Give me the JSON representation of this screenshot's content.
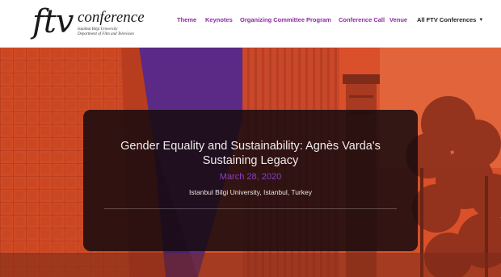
{
  "logo": {
    "main": "ftv",
    "word": "conference",
    "sub_lines": [
      "Istanbul Bilgi University",
      "Department of Film and Television"
    ]
  },
  "nav": {
    "items": [
      {
        "label": "Theme"
      },
      {
        "label": "Keynotes"
      },
      {
        "label": "Organizing Committee"
      },
      {
        "label": "Program"
      },
      {
        "label": "Conference Call"
      },
      {
        "label": "Venue"
      }
    ],
    "dropdown": {
      "label": "All FTV Conferences",
      "caret": "▼"
    }
  },
  "event": {
    "title": "Gender Equality and Sustainability: Agnès Varda's Sustaining Legacy",
    "date": "March 28, 2020",
    "venue": "Istanbul Bilgi University, Istanbul, Turkey"
  },
  "colors": {
    "nav_link": "#8a2a9f",
    "date_accent": "#8b3fc6",
    "hero_orange": "#d9502a",
    "hero_purple": "#5a2a86"
  }
}
